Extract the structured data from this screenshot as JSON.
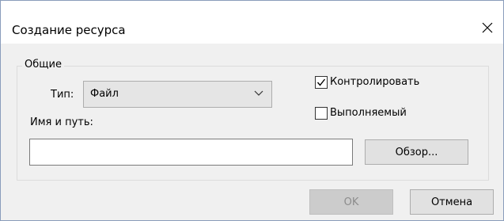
{
  "dialog": {
    "title": "Создание ресурса"
  },
  "general_group": {
    "label": "Общие",
    "type_label": "Тип:",
    "type_value": "Файл",
    "path_label": "Имя и путь:",
    "path_value": "",
    "browse_label": "Обзор...",
    "monitor": {
      "label": "Контролировать",
      "checked": true
    },
    "executable": {
      "label": "Выполняемый",
      "checked": false
    }
  },
  "buttons": {
    "ok_label": "OK",
    "ok_enabled": false,
    "cancel_label": "Отмена"
  },
  "icons": {
    "close": "close-icon",
    "dropdown": "chevron-down-icon",
    "check": "checkmark-icon"
  }
}
